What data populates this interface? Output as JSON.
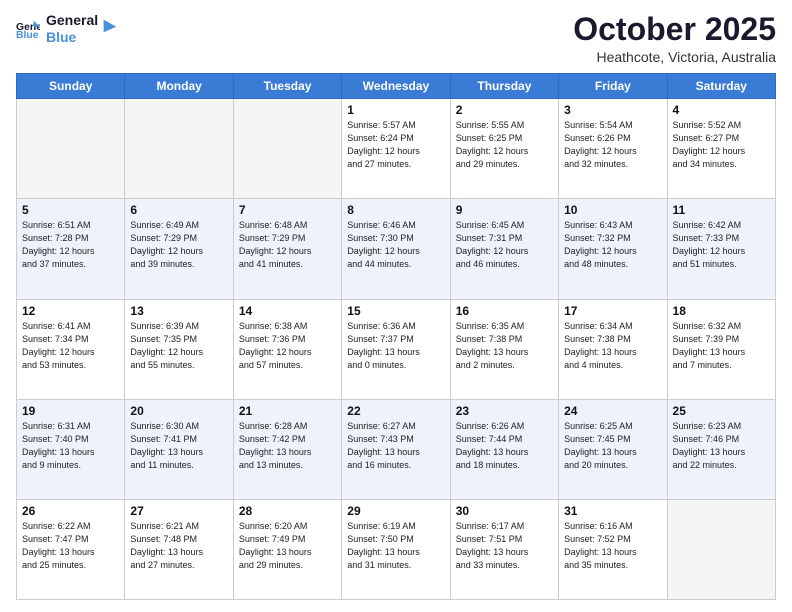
{
  "logo": {
    "line1": "General",
    "line2": "Blue"
  },
  "title": "October 2025",
  "location": "Heathcote, Victoria, Australia",
  "days_of_week": [
    "Sunday",
    "Monday",
    "Tuesday",
    "Wednesday",
    "Thursday",
    "Friday",
    "Saturday"
  ],
  "weeks": [
    [
      {
        "day": "",
        "info": ""
      },
      {
        "day": "",
        "info": ""
      },
      {
        "day": "",
        "info": ""
      },
      {
        "day": "1",
        "info": "Sunrise: 5:57 AM\nSunset: 6:24 PM\nDaylight: 12 hours\nand 27 minutes."
      },
      {
        "day": "2",
        "info": "Sunrise: 5:55 AM\nSunset: 6:25 PM\nDaylight: 12 hours\nand 29 minutes."
      },
      {
        "day": "3",
        "info": "Sunrise: 5:54 AM\nSunset: 6:26 PM\nDaylight: 12 hours\nand 32 minutes."
      },
      {
        "day": "4",
        "info": "Sunrise: 5:52 AM\nSunset: 6:27 PM\nDaylight: 12 hours\nand 34 minutes."
      }
    ],
    [
      {
        "day": "5",
        "info": "Sunrise: 6:51 AM\nSunset: 7:28 PM\nDaylight: 12 hours\nand 37 minutes."
      },
      {
        "day": "6",
        "info": "Sunrise: 6:49 AM\nSunset: 7:29 PM\nDaylight: 12 hours\nand 39 minutes."
      },
      {
        "day": "7",
        "info": "Sunrise: 6:48 AM\nSunset: 7:29 PM\nDaylight: 12 hours\nand 41 minutes."
      },
      {
        "day": "8",
        "info": "Sunrise: 6:46 AM\nSunset: 7:30 PM\nDaylight: 12 hours\nand 44 minutes."
      },
      {
        "day": "9",
        "info": "Sunrise: 6:45 AM\nSunset: 7:31 PM\nDaylight: 12 hours\nand 46 minutes."
      },
      {
        "day": "10",
        "info": "Sunrise: 6:43 AM\nSunset: 7:32 PM\nDaylight: 12 hours\nand 48 minutes."
      },
      {
        "day": "11",
        "info": "Sunrise: 6:42 AM\nSunset: 7:33 PM\nDaylight: 12 hours\nand 51 minutes."
      }
    ],
    [
      {
        "day": "12",
        "info": "Sunrise: 6:41 AM\nSunset: 7:34 PM\nDaylight: 12 hours\nand 53 minutes."
      },
      {
        "day": "13",
        "info": "Sunrise: 6:39 AM\nSunset: 7:35 PM\nDaylight: 12 hours\nand 55 minutes."
      },
      {
        "day": "14",
        "info": "Sunrise: 6:38 AM\nSunset: 7:36 PM\nDaylight: 12 hours\nand 57 minutes."
      },
      {
        "day": "15",
        "info": "Sunrise: 6:36 AM\nSunset: 7:37 PM\nDaylight: 13 hours\nand 0 minutes."
      },
      {
        "day": "16",
        "info": "Sunrise: 6:35 AM\nSunset: 7:38 PM\nDaylight: 13 hours\nand 2 minutes."
      },
      {
        "day": "17",
        "info": "Sunrise: 6:34 AM\nSunset: 7:38 PM\nDaylight: 13 hours\nand 4 minutes."
      },
      {
        "day": "18",
        "info": "Sunrise: 6:32 AM\nSunset: 7:39 PM\nDaylight: 13 hours\nand 7 minutes."
      }
    ],
    [
      {
        "day": "19",
        "info": "Sunrise: 6:31 AM\nSunset: 7:40 PM\nDaylight: 13 hours\nand 9 minutes."
      },
      {
        "day": "20",
        "info": "Sunrise: 6:30 AM\nSunset: 7:41 PM\nDaylight: 13 hours\nand 11 minutes."
      },
      {
        "day": "21",
        "info": "Sunrise: 6:28 AM\nSunset: 7:42 PM\nDaylight: 13 hours\nand 13 minutes."
      },
      {
        "day": "22",
        "info": "Sunrise: 6:27 AM\nSunset: 7:43 PM\nDaylight: 13 hours\nand 16 minutes."
      },
      {
        "day": "23",
        "info": "Sunrise: 6:26 AM\nSunset: 7:44 PM\nDaylight: 13 hours\nand 18 minutes."
      },
      {
        "day": "24",
        "info": "Sunrise: 6:25 AM\nSunset: 7:45 PM\nDaylight: 13 hours\nand 20 minutes."
      },
      {
        "day": "25",
        "info": "Sunrise: 6:23 AM\nSunset: 7:46 PM\nDaylight: 13 hours\nand 22 minutes."
      }
    ],
    [
      {
        "day": "26",
        "info": "Sunrise: 6:22 AM\nSunset: 7:47 PM\nDaylight: 13 hours\nand 25 minutes."
      },
      {
        "day": "27",
        "info": "Sunrise: 6:21 AM\nSunset: 7:48 PM\nDaylight: 13 hours\nand 27 minutes."
      },
      {
        "day": "28",
        "info": "Sunrise: 6:20 AM\nSunset: 7:49 PM\nDaylight: 13 hours\nand 29 minutes."
      },
      {
        "day": "29",
        "info": "Sunrise: 6:19 AM\nSunset: 7:50 PM\nDaylight: 13 hours\nand 31 minutes."
      },
      {
        "day": "30",
        "info": "Sunrise: 6:17 AM\nSunset: 7:51 PM\nDaylight: 13 hours\nand 33 minutes."
      },
      {
        "day": "31",
        "info": "Sunrise: 6:16 AM\nSunset: 7:52 PM\nDaylight: 13 hours\nand 35 minutes."
      },
      {
        "day": "",
        "info": ""
      }
    ]
  ]
}
